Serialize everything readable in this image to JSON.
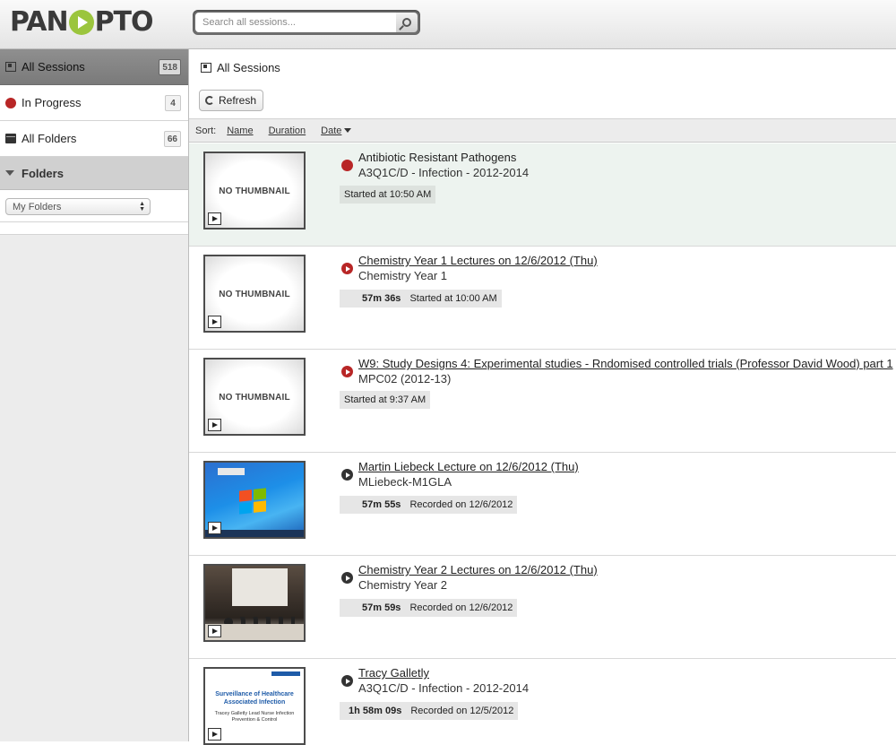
{
  "header": {
    "logo_before": "PAN",
    "logo_after": "PTO",
    "search_placeholder": "Search all sessions..."
  },
  "sidebar": {
    "items": [
      {
        "label": "All Sessions",
        "count": "518",
        "icon": "sessions-icon"
      },
      {
        "label": "In Progress",
        "count": "4",
        "icon": "in-progress-icon"
      },
      {
        "label": "All Folders",
        "count": "66",
        "icon": "folders-icon"
      }
    ],
    "folders_heading": "Folders",
    "folder_select_value": "My Folders"
  },
  "main": {
    "title": "All Sessions",
    "refresh_label": "Refresh",
    "sort": {
      "label": "Sort:",
      "name": "Name",
      "duration": "Duration",
      "date": "Date"
    },
    "no_thumbnail": "NO THUMBNAIL",
    "sessions": [
      {
        "title": "Antibiotic Resistant Pathogens",
        "folder": "A3Q1C/D - Infection - 2012-2014",
        "duration": "",
        "meta": "Started at 10:50 AM"
      },
      {
        "title": "Chemistry Year 1 Lectures on 12/6/2012 (Thu)",
        "folder": "Chemistry Year 1",
        "duration": "57m 36s",
        "meta": "Started at 10:00 AM"
      },
      {
        "title": "W9: Study Designs 4: Experimental studies - Rndomised controlled trials (Professor David Wood) part 1",
        "folder": "MPC02 (2012-13)",
        "duration": "",
        "meta": "Started at 9:37 AM"
      },
      {
        "title": "Martin Liebeck Lecture on 12/6/2012 (Thu)",
        "folder": "MLiebeck-M1GLA",
        "duration": "57m 55s",
        "meta": "Recorded on 12/6/2012"
      },
      {
        "title": "Chemistry Year 2 Lectures on 12/6/2012 (Thu)",
        "folder": "Chemistry Year 2",
        "duration": "57m 59s",
        "meta": "Recorded on 12/6/2012"
      },
      {
        "title": "Tracy Galletly",
        "folder": "A3Q1C/D - Infection - 2012-2014",
        "duration": "1h 58m 09s",
        "meta": "Recorded on 12/5/2012"
      }
    ],
    "slide_thumb": {
      "title": "Surveillance of Healthcare Associated Infection",
      "subtitle": "Tracey Galletly Lead Nurse Infection Prevention & Control"
    }
  },
  "colors": {
    "live_row": "#edf3ef",
    "status_red": "#b82626",
    "logo_green": "#9bc53d"
  }
}
